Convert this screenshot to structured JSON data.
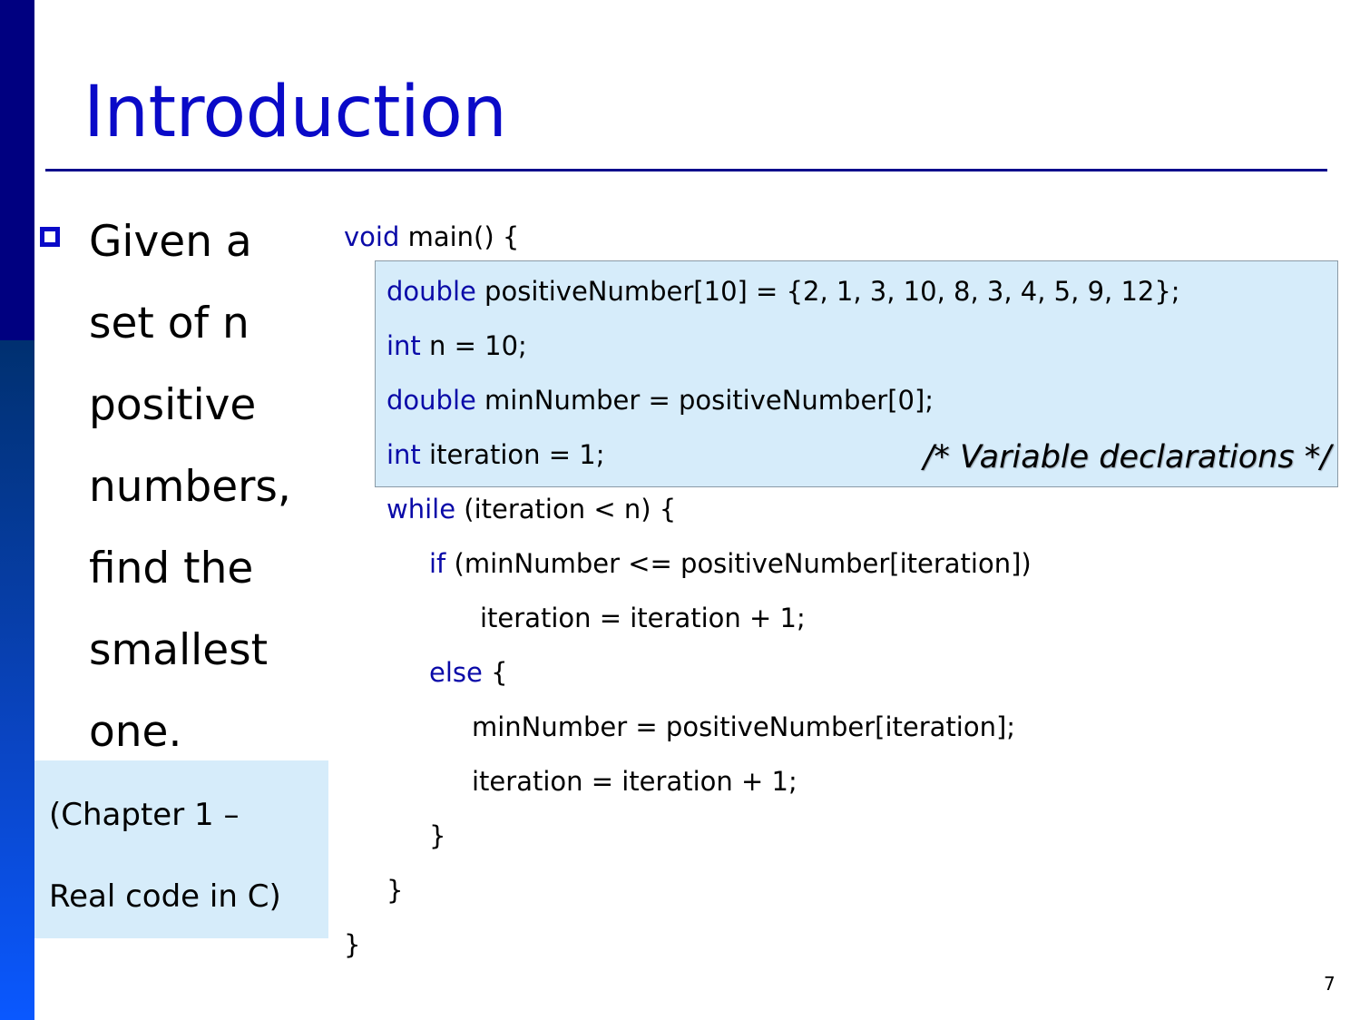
{
  "slide": {
    "title": "Introduction",
    "page_number": "7",
    "colors": {
      "title": "#0a0ac8",
      "keyword": "#0a0aa8",
      "sidebar_top": "#000080",
      "highlight_bg": "#d6ecfa"
    }
  },
  "bullet": {
    "icon": "hollow-square-bullet",
    "lines": [
      "Given a",
      "set of n",
      "positive",
      "numbers,",
      "find the",
      "smallest",
      "one."
    ]
  },
  "note": {
    "lines": [
      "(Chapter 1 –",
      "Real code in C)"
    ]
  },
  "code": {
    "lines": [
      {
        "kw": "void",
        "rest": " main() {"
      },
      {
        "kw": "double",
        "rest": " positiveNumber[10] = {2, 1, 3, 10, 8, 3, 4, 5, 9, 12};"
      },
      {
        "kw": "int",
        "rest": " n = 10;"
      },
      {
        "kw": "double",
        "rest": " minNumber = positiveNumber[0];"
      },
      {
        "kw": "int",
        "rest": " iteration = 1;"
      },
      {
        "kw": "while",
        "rest": " (iteration < n) {"
      },
      {
        "kw": "if",
        "rest": " (minNumber <= positiveNumber[iteration])"
      },
      {
        "kw": "",
        "rest": "iteration = iteration + 1;"
      },
      {
        "kw": "else",
        "rest": " {"
      },
      {
        "kw": "",
        "rest": "minNumber = positiveNumber[iteration];"
      },
      {
        "kw": "",
        "rest": "iteration = iteration + 1;"
      },
      {
        "kw": "",
        "rest": "}"
      },
      {
        "kw": "",
        "rest": "}"
      },
      {
        "kw": "",
        "rest": "}"
      }
    ],
    "comment": "/* Variable declarations */"
  }
}
